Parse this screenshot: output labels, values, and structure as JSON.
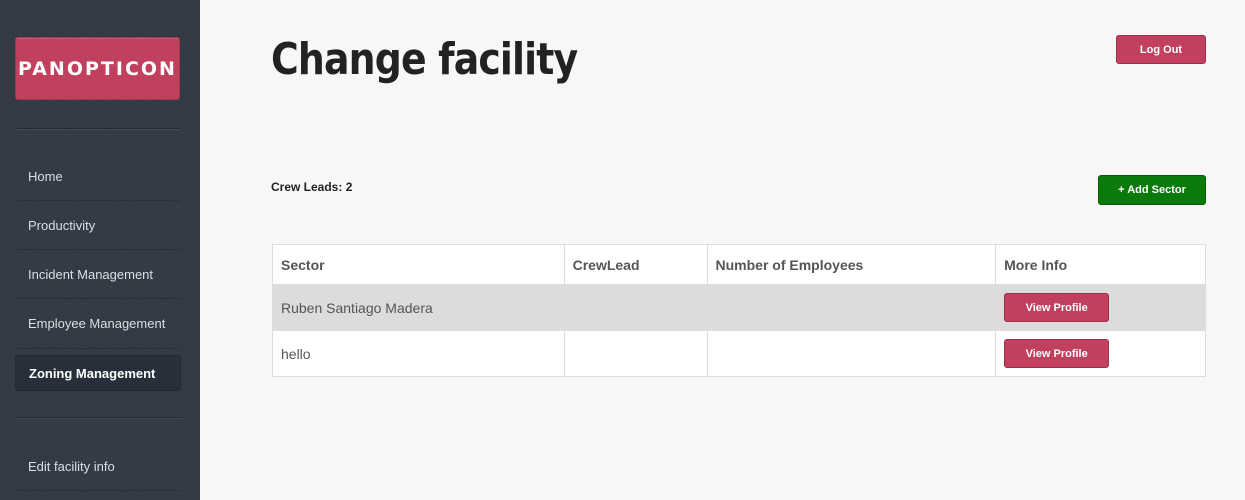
{
  "brand": {
    "name": "PANOPTICON"
  },
  "sidebar": {
    "items": [
      {
        "label": "Home"
      },
      {
        "label": "Productivity"
      },
      {
        "label": "Incident Management"
      },
      {
        "label": "Employee Management"
      },
      {
        "label": "Zoning Management",
        "active": true
      }
    ],
    "secondary_items": [
      {
        "label": "Edit facility info"
      }
    ]
  },
  "header": {
    "title": "Change facility",
    "logout_label": "Log Out"
  },
  "summary": {
    "crew_leads_text": "Crew Leads: 2",
    "add_sector_label": "+ Add Sector"
  },
  "table": {
    "columns": [
      "Sector",
      "CrewLead",
      "Number of Employees",
      "More Info"
    ],
    "rows": [
      {
        "sector": "Ruben Santiago Madera",
        "crewlead": "",
        "employees": "",
        "action_label": "View Profile"
      },
      {
        "sector": "hello",
        "crewlead": "",
        "employees": "",
        "action_label": "View Profile"
      }
    ]
  },
  "colors": {
    "sidebar_bg": "#323a45",
    "accent": "#c0405d",
    "add_button": "#0a7a0a"
  }
}
